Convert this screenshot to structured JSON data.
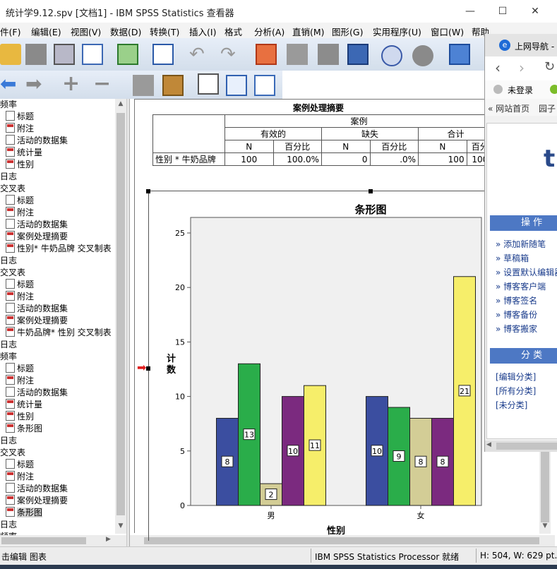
{
  "window": {
    "title": "统计学9.12.spv [文档1] - IBM SPSS Statistics 查看器",
    "minimize": "—",
    "maximize": "☐",
    "close": "✕"
  },
  "menu": [
    "件(F)",
    "编辑(E)",
    "视图(V)",
    "数据(D)",
    "转换(T)",
    "插入(I)",
    "格式",
    "分析(A)",
    "直销(M)",
    "图形(G)",
    "实用程序(U)",
    "窗口(W)",
    "帮助"
  ],
  "outline": [
    {
      "label": "频率",
      "level": 0
    },
    {
      "label": "标题",
      "level": 1,
      "icon": "title-icon"
    },
    {
      "label": "附注",
      "level": 1,
      "icon": "notes-icon"
    },
    {
      "label": "活动的数据集",
      "level": 1,
      "icon": "dataset-icon"
    },
    {
      "label": "统计量",
      "level": 1,
      "icon": "table-icon"
    },
    {
      "label": "性别",
      "level": 1,
      "icon": "table-icon"
    },
    {
      "label": "日志",
      "level": 0
    },
    {
      "label": "交叉表",
      "level": 0
    },
    {
      "label": "标题",
      "level": 1,
      "icon": "title-icon"
    },
    {
      "label": "附注",
      "level": 1,
      "icon": "notes-icon"
    },
    {
      "label": "活动的数据集",
      "level": 1,
      "icon": "dataset-icon"
    },
    {
      "label": "案例处理摘要",
      "level": 1,
      "icon": "table-icon"
    },
    {
      "label": "性别* 牛奶品牌 交叉制表",
      "level": 1,
      "icon": "table-icon"
    },
    {
      "label": "日志",
      "level": 0
    },
    {
      "label": "交叉表",
      "level": 0
    },
    {
      "label": "标题",
      "level": 1,
      "icon": "title-icon"
    },
    {
      "label": "附注",
      "level": 1,
      "icon": "notes-icon"
    },
    {
      "label": "活动的数据集",
      "level": 1,
      "icon": "dataset-icon"
    },
    {
      "label": "案例处理摘要",
      "level": 1,
      "icon": "table-icon"
    },
    {
      "label": "牛奶品牌* 性别 交叉制表",
      "level": 1,
      "icon": "table-icon"
    },
    {
      "label": "日志",
      "level": 0
    },
    {
      "label": "频率",
      "level": 0
    },
    {
      "label": "标题",
      "level": 1,
      "icon": "title-icon"
    },
    {
      "label": "附注",
      "level": 1,
      "icon": "notes-icon"
    },
    {
      "label": "活动的数据集",
      "level": 1,
      "icon": "dataset-icon"
    },
    {
      "label": "统计量",
      "level": 1,
      "icon": "table-icon"
    },
    {
      "label": "性别",
      "level": 1,
      "icon": "table-icon"
    },
    {
      "label": "条形图",
      "level": 1,
      "icon": "chart-icon"
    },
    {
      "label": "日志",
      "level": 0
    },
    {
      "label": "交叉表",
      "level": 0
    },
    {
      "label": "标题",
      "level": 1,
      "icon": "title-icon"
    },
    {
      "label": "附注",
      "level": 1,
      "icon": "notes-icon"
    },
    {
      "label": "活动的数据集",
      "level": 1,
      "icon": "dataset-icon"
    },
    {
      "label": "案例处理摘要",
      "level": 1,
      "icon": "table-icon"
    },
    {
      "label": "条形图",
      "level": 1,
      "icon": "chart-icon",
      "selected": true
    },
    {
      "label": "日志",
      "level": 0
    },
    {
      "label": "频率",
      "level": 0
    }
  ],
  "case_table": {
    "title": "案例处理摘要",
    "group": "案例",
    "subgroups": [
      "有效的",
      "缺失",
      "合计"
    ],
    "col_headers": [
      "N",
      "百分比",
      "N",
      "百分比",
      "N",
      "百分"
    ],
    "row_label": "性别 * 牛奶品牌",
    "row_values": [
      "100",
      "100.0%",
      "0",
      ".0%",
      "100",
      "100"
    ]
  },
  "chart_data": {
    "type": "bar",
    "title": "条形图",
    "xlabel": "性别",
    "ylabel": "计数",
    "categories": [
      "男",
      "女"
    ],
    "ylim": [
      0,
      25
    ],
    "yticks": [
      0,
      5,
      10,
      15,
      20,
      25
    ],
    "series": [
      {
        "color": "#3b4ea0",
        "values": [
          8,
          10
        ]
      },
      {
        "color": "#2aad4a",
        "values": [
          13,
          9
        ]
      },
      {
        "color": "#d3cd96",
        "values": [
          2,
          8
        ]
      },
      {
        "color": "#7b2a7f",
        "values": [
          10,
          8
        ]
      },
      {
        "color": "#f6ee6a",
        "values": [
          11,
          21
        ]
      }
    ]
  },
  "browser": {
    "tab": "上网导航 -",
    "login": "未登录",
    "bookmarks": [
      "« 网站首页",
      "园子"
    ],
    "section_ops": "操 作",
    "ops_links": [
      "» 添加新随笔",
      "» 草稿箱",
      "» 设置默认编辑器",
      "» 博客客户端",
      "» 博客签名",
      "» 博客备份",
      "» 博客搬家"
    ],
    "section_cat": "分 类",
    "cat_links": [
      "[编辑分类]",
      "[所有分类]",
      "[未分类]"
    ]
  },
  "status": {
    "left": "击编辑 图表",
    "processor": "IBM SPSS Statistics Processor 就绪",
    "size": "H: 504, W: 629 pt."
  }
}
